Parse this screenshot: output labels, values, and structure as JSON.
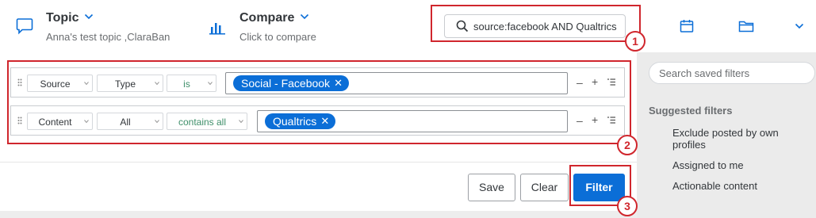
{
  "header": {
    "topic": {
      "title": "Topic",
      "subtitle": "Anna's test topic ,ClaraBan"
    },
    "compare": {
      "title": "Compare",
      "subtitle": "Click to compare"
    },
    "search": {
      "value": "source:facebook AND Qualtrics"
    }
  },
  "filters": {
    "rows": [
      {
        "field": "Source",
        "type": "Type",
        "operator": "is",
        "chip": "Social - Facebook",
        "remove": "–",
        "add": "+"
      },
      {
        "field": "Content",
        "type": "All",
        "operator": "contains all",
        "chip": "Qualtrics",
        "remove": "–",
        "add": "+"
      }
    ]
  },
  "actions": {
    "save": "Save",
    "clear": "Clear",
    "filter": "Filter"
  },
  "saved_filters": {
    "search_placeholder": "Search saved filters",
    "suggested_heading": "Suggested filters",
    "items": [
      "Exclude posted by own profiles",
      "Assigned to me",
      "Actionable content"
    ]
  },
  "annotations": {
    "badge1": "1",
    "badge2": "2",
    "badge3": "3"
  },
  "colors": {
    "accent": "#0b6ed7",
    "annotation": "#d0262d",
    "operator_text": "#3f8f6a"
  }
}
